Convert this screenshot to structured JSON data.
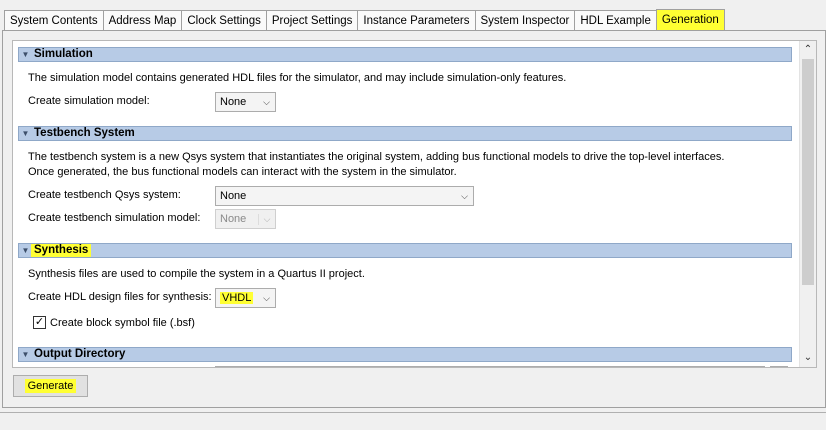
{
  "tabs": [
    {
      "label": "System Contents"
    },
    {
      "label": "Address Map"
    },
    {
      "label": "Clock Settings"
    },
    {
      "label": "Project Settings"
    },
    {
      "label": "Instance Parameters"
    },
    {
      "label": "System Inspector"
    },
    {
      "label": "HDL Example"
    },
    {
      "label": "Generation"
    }
  ],
  "sections": {
    "simulation": {
      "title": "Simulation",
      "description": "The simulation model contains generated HDL files for the simulator, and may include simulation-only features.",
      "model_label": "Create simulation model:",
      "model_value": "None"
    },
    "testbench": {
      "title": "Testbench System",
      "description_line1": "The testbench system is a new Qsys system that instantiates the original system, adding bus functional models to drive the top-level interfaces.",
      "description_line2": "Once generated, the bus functional models can interact with the system in the simulator.",
      "qsys_label": "Create testbench Qsys system:",
      "qsys_value": "None",
      "sim_label": "Create testbench simulation model:",
      "sim_value": "None"
    },
    "synthesis": {
      "title": "Synthesis",
      "description": "Synthesis files are used to compile the system in a Quartus II project.",
      "hdl_label": "Create HDL design files for synthesis:",
      "hdl_value": "VHDL",
      "bsf_label": "Create block symbol file (.bsf)",
      "bsf_checked": true
    },
    "output": {
      "title": "Output Directory"
    }
  },
  "generate_button": "Generate",
  "colors": {
    "highlight": "#ffff33",
    "section_header": "#b7cbe6"
  }
}
